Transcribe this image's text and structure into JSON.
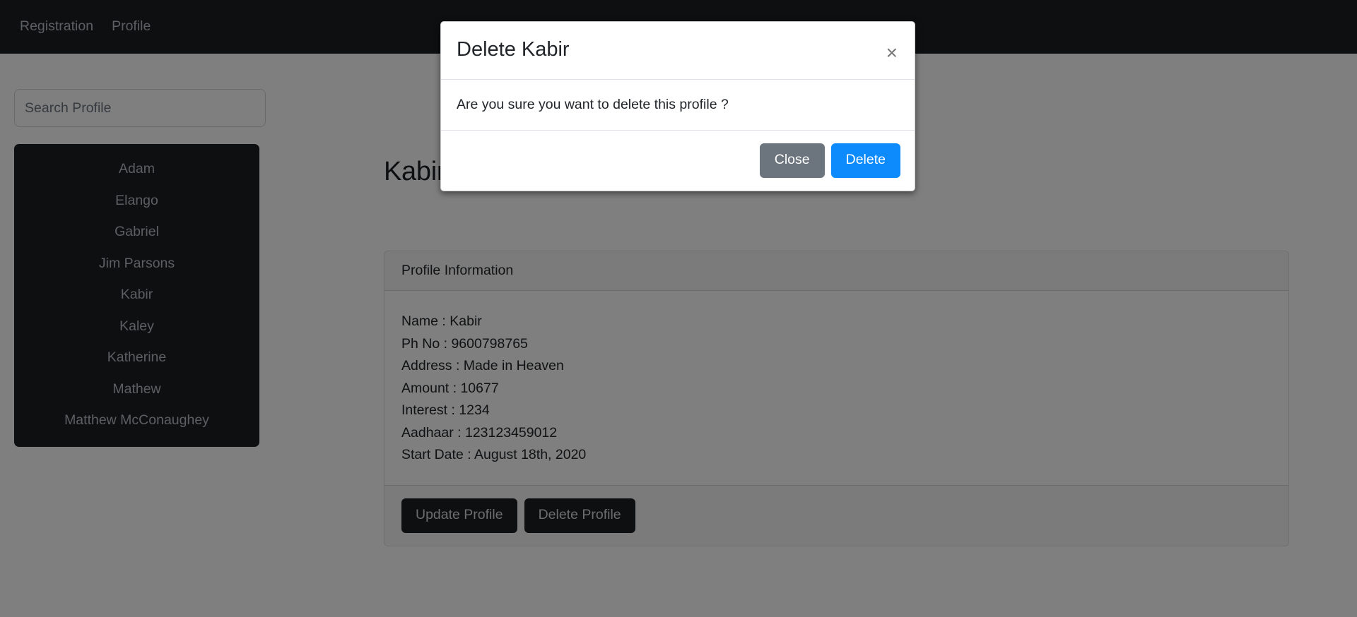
{
  "navbar": {
    "links": [
      {
        "label": "Registration",
        "name": "nav-link-registration"
      },
      {
        "label": "Profile",
        "name": "nav-link-profile"
      }
    ]
  },
  "sidebar": {
    "search": {
      "placeholder": "Search Profile",
      "value": ""
    },
    "profiles": [
      {
        "label": "Adam"
      },
      {
        "label": "Elango"
      },
      {
        "label": "Gabriel"
      },
      {
        "label": "Jim Parsons"
      },
      {
        "label": "Kabir"
      },
      {
        "label": "Kaley"
      },
      {
        "label": "Katherine"
      },
      {
        "label": "Mathew"
      },
      {
        "label": "Matthew McConaughey"
      }
    ]
  },
  "main": {
    "title": "Kabir",
    "card": {
      "header": "Profile Information",
      "fields": [
        {
          "label": "Name",
          "value": "Kabir",
          "text": "Name : Kabir"
        },
        {
          "label": "Ph No",
          "value": "9600798765",
          "text": "Ph No : 9600798765"
        },
        {
          "label": "Address",
          "value": "Made in Heaven",
          "text": "Address : Made in Heaven"
        },
        {
          "label": "Amount",
          "value": "10677",
          "text": "Amount : 10677"
        },
        {
          "label": "Interest",
          "value": "1234",
          "text": "Interest : 1234"
        },
        {
          "label": "Aadhaar",
          "value": "123123459012",
          "text": "Aadhaar : 123123459012"
        },
        {
          "label": "Start Date",
          "value": "August 18th, 2020",
          "text": "Start Date : August 18th, 2020"
        }
      ],
      "actions": {
        "update_label": "Update Profile",
        "delete_label": "Delete Profile"
      }
    }
  },
  "modal": {
    "title": "Delete Kabir",
    "close_glyph": "×",
    "body": "Are you sure you want to delete this profile ?",
    "close_label": "Close",
    "delete_label": "Delete"
  },
  "colors": {
    "navbar_bg": "#1b1f22",
    "dark_button": "#1b1f22",
    "secondary": "#6c757d",
    "primary": "#0d8bfd",
    "backdrop": "rgba(0,0,0,0.5)"
  }
}
